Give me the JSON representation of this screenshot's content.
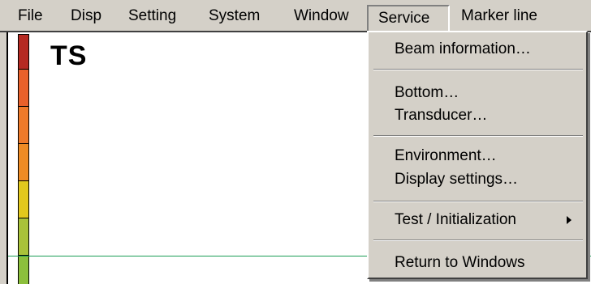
{
  "menubar": {
    "items": [
      "File",
      "Disp",
      "Setting",
      "System",
      "Window",
      "Service",
      "Marker line"
    ],
    "open_index": 5
  },
  "display": {
    "label": "TS"
  },
  "scale": {
    "colors": [
      "#b52a22",
      "#e8612b",
      "#ee7a2a",
      "#ee8b24",
      "#e2c81d",
      "#a9c23a",
      "#8cbf3c"
    ]
  },
  "service_menu": {
    "items": [
      "Beam information…",
      "Bottom…",
      "Transducer…",
      "Environment…",
      "Display settings…",
      "Test / Initialization",
      "Return to Windows"
    ],
    "submenu_item_index": 5
  },
  "colors": {
    "menu_bg": "#d4d0c8",
    "marker_line": "#1a9c55"
  }
}
